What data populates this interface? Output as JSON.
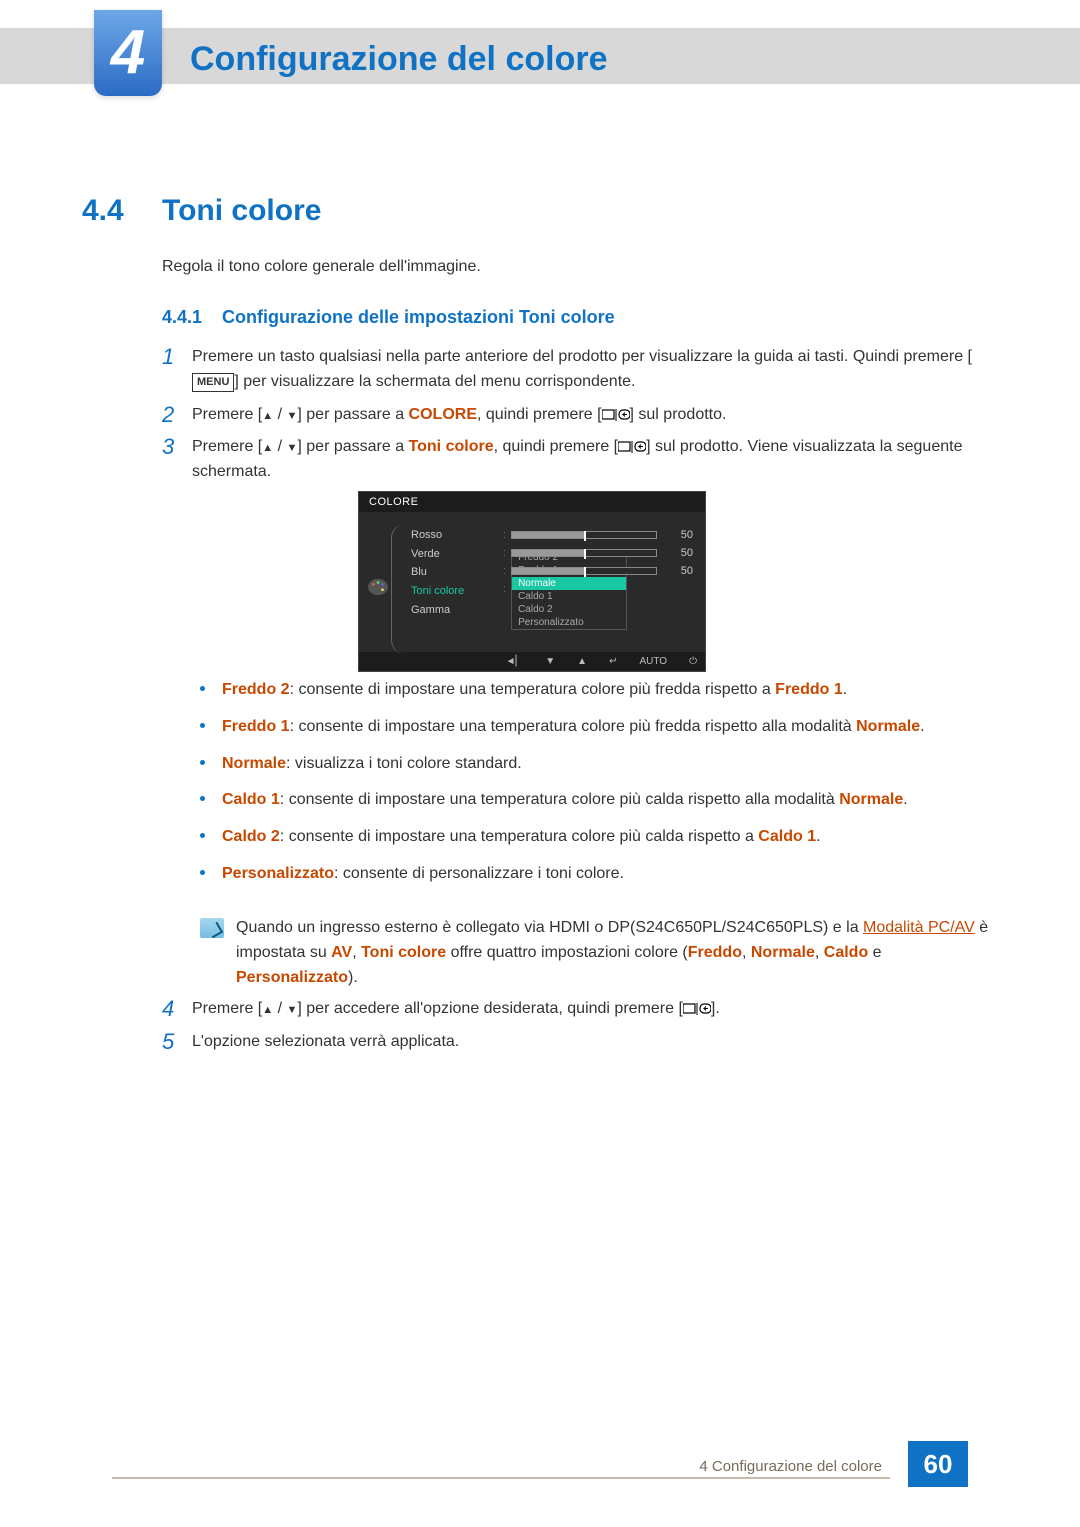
{
  "chapter": {
    "number": "4",
    "title": "Configurazione del colore"
  },
  "section": {
    "number": "4.4",
    "title": "Toni colore"
  },
  "intro": "Regola il tono colore generale dell'immagine.",
  "subsection": {
    "number": "4.4.1",
    "title": "Configurazione delle impostazioni Toni colore"
  },
  "steps": {
    "s1a": "Premere un tasto qualsiasi nella parte anteriore del prodotto per visualizzare la guida ai tasti. Quindi premere [",
    "s1_menu": "MENU",
    "s1b": "] per visualizzare la schermata del menu corrispondente.",
    "s2a": "Premere [",
    "s2b": "] per passare a ",
    "s2_hl": "COLORE",
    "s2c": ", quindi premere [",
    "s2d": "] sul prodotto.",
    "s3a": "Premere [",
    "s3b": "] per passare a ",
    "s3_hl": "Toni colore",
    "s3c": ", quindi premere [",
    "s3d": "] sul prodotto. Viene visualizzata la seguente schermata.",
    "s4a": "Premere [",
    "s4b": "] per accedere all'opzione desiderata, quindi premere [",
    "s4c": "].",
    "s5": "L'opzione selezionata verrà applicata."
  },
  "osd": {
    "title": "COLORE",
    "labels": {
      "rosso": "Rosso",
      "verde": "Verde",
      "blu": "Blu",
      "toni": "Toni colore",
      "gamma": "Gamma"
    },
    "val50": "50",
    "options": [
      "Freddo 2",
      "Freddo 1",
      "Normale",
      "Caldo 1",
      "Caldo 2",
      "Personalizzato"
    ],
    "footer_auto": "AUTO"
  },
  "bullets": {
    "b1_hl": "Freddo 2",
    "b1_txt": ": consente di impostare una temperatura colore più fredda rispetto a ",
    "b1_hl2": "Freddo 1",
    "b1_end": ".",
    "b2_hl": "Freddo 1",
    "b2_txt": ": consente di impostare una temperatura colore più fredda rispetto alla modalità ",
    "b2_hl2": "Normale",
    "b2_end": ".",
    "b3_hl": "Normale",
    "b3_txt": ": visualizza i toni colore standard.",
    "b4_hl": "Caldo 1",
    "b4_txt": ": consente di impostare una temperatura colore più calda rispetto alla modalità ",
    "b4_hl2": "Normale",
    "b4_end": ".",
    "b5_hl": "Caldo 2",
    "b5_txt": ": consente di impostare una temperatura colore più calda rispetto a ",
    "b5_hl2": "Caldo 1",
    "b5_end": ".",
    "b6_hl": "Personalizzato",
    "b6_txt": ": consente di personalizzare i toni colore."
  },
  "note": {
    "a": "Quando un ingresso esterno è collegato via HDMI o DP(S24C650PL/S24C650PLS) e la ",
    "link1": "Modalità PC/AV",
    "b": " è impostata su ",
    "hl_av": "AV",
    "c": ", ",
    "hl_tc": "Toni colore",
    "d": " offre quattro impostazioni colore (",
    "hl_f": "Freddo",
    "e": ", ",
    "hl_n": "Normale",
    "f": ", ",
    "hl_ca": "Caldo",
    "g": " e ",
    "hl_p": "Personalizzato",
    "h": ")."
  },
  "footer": {
    "text": "4 Configurazione del colore",
    "page": "60"
  }
}
